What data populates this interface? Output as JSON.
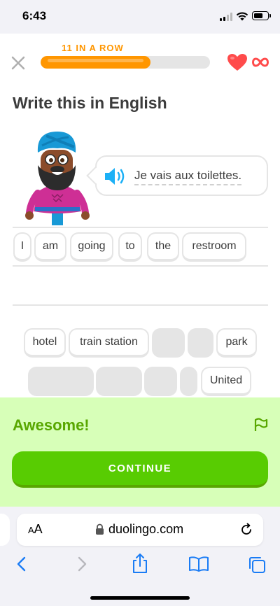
{
  "status_bar": {
    "time": "6:43"
  },
  "header": {
    "streak_label": "11 IN A ROW",
    "progress_fraction": 0.65,
    "lives": "∞"
  },
  "prompt": {
    "title": "Write this in English"
  },
  "bubble": {
    "sentence": "Je vais aux toilettes."
  },
  "answer_tiles": [
    "I",
    "am",
    "going",
    "to",
    "the",
    "restroom"
  ],
  "word_bank": {
    "row1": [
      {
        "label": "hotel",
        "used": false
      },
      {
        "label": "train station",
        "used": false
      },
      {
        "label": "",
        "used": true
      },
      {
        "label": "",
        "used": true
      },
      {
        "label": "park",
        "used": false
      }
    ],
    "row2": [
      {
        "label": "",
        "used": true
      },
      {
        "label": "",
        "used": true
      },
      {
        "label": "",
        "used": true
      },
      {
        "label": "",
        "used": true
      },
      {
        "label": "United",
        "used": false
      }
    ]
  },
  "feedback": {
    "title": "Awesome!",
    "continue_label": "CONTINUE"
  },
  "browser": {
    "aa_small": "A",
    "aa_large": "A",
    "url": "duolingo.com"
  },
  "colors": {
    "accent_orange": "#ff9600",
    "success_green": "#58cc02",
    "heart_red": "#ff4b4b",
    "feedback_bg": "#d7ffb8"
  },
  "icons": [
    "close-icon",
    "heart-icon",
    "infinity-icon",
    "speaker-icon",
    "flag-icon",
    "lock-icon",
    "reload-icon",
    "back-icon",
    "forward-icon",
    "share-icon",
    "bookmarks-icon",
    "tabs-icon"
  ]
}
